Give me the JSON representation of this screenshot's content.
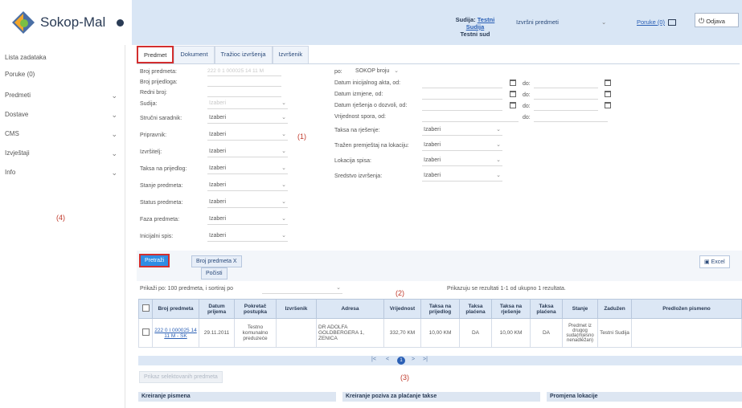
{
  "app": {
    "name": "Sokop-Mal",
    "header": {
      "judge_label": "Sudija:",
      "judge_name": "Testni Sudija",
      "court": "Testni sud",
      "module_select": "Izvršni predmeti",
      "messages_link": "Poruke (0)",
      "logout": "Odjava"
    }
  },
  "sidebar": {
    "items": [
      {
        "label": "Lista zadataka",
        "expandable": false
      },
      {
        "label": "Poruke (0)",
        "expandable": false
      },
      {
        "label": "Predmeti",
        "expandable": true
      },
      {
        "label": "Dostave",
        "expandable": true
      },
      {
        "label": "CMS",
        "expandable": true
      },
      {
        "label": "Izvještaji",
        "expandable": true
      },
      {
        "label": "Info",
        "expandable": true
      }
    ]
  },
  "annotations": [
    "(1)",
    "(2)",
    "(3)",
    "(4)"
  ],
  "tabs": [
    "Predmet",
    "Dokument",
    "Tražioc izvršenja",
    "Izvršenik"
  ],
  "form": {
    "left": [
      {
        "label": "Broj predmeta:",
        "type": "input",
        "value": "222 0 1 000025 14 11 M"
      },
      {
        "label": "Broj prijedloga:",
        "type": "input",
        "value": ""
      },
      {
        "label": "Redni broj:",
        "type": "input",
        "value": ""
      },
      {
        "label": "Sudija:",
        "type": "select",
        "value": "Izaberi",
        "disabled": true
      },
      {
        "label": "Stručni saradnik:",
        "type": "select",
        "value": "Izaberi"
      },
      {
        "label": "Pripravnik:",
        "type": "select",
        "value": "Izaberi"
      },
      {
        "label": "Izvršitelj:",
        "type": "select",
        "value": "Izaberi"
      },
      {
        "label": "Taksa na prijedlog:",
        "type": "select",
        "value": "Izaberi"
      },
      {
        "label": "Stanje predmeta:",
        "type": "select",
        "value": "Izaberi"
      },
      {
        "label": "Status predmeta:",
        "type": "select",
        "value": "Izaberi"
      },
      {
        "label": "Faza predmeta:",
        "type": "select",
        "value": "Izaberi"
      },
      {
        "label": "Inicijalni spis:",
        "type": "select",
        "value": "Izaberi"
      }
    ],
    "right": {
      "po_label": "po:",
      "po_value": "SOKOP broju",
      "date_rows": [
        {
          "label": "Datum inicijalnog akta, od:",
          "to": "do:"
        },
        {
          "label": "Datum izmjene, od:",
          "to": "do:"
        },
        {
          "label": "Datum rješenja o dozvoli, od:",
          "to": "do:"
        }
      ],
      "value_row": {
        "label": "Vrijednost spora, od:",
        "to": "do:"
      },
      "selects": [
        {
          "label": "Taksa na rješenje:",
          "value": "Izaberi"
        },
        {
          "label": "Tražen premještaj na lokaciju:",
          "value": "Izaberi"
        },
        {
          "label": "Lokacija spisa:",
          "value": "Izaberi"
        },
        {
          "label": "Sredstvo izvršenja:",
          "value": "Izaberi"
        }
      ]
    }
  },
  "actions": {
    "search": "Pretraži",
    "case_number": "Broj predmeta X",
    "clear": "Počisti",
    "excel": "Excel"
  },
  "listing": {
    "show_prefix": "Prikaži po:",
    "page_size": "100",
    "show_suffix": "predmeta, i sortiraj po",
    "results_text": "Prikazuju se rezultati 1-1 od ukupno 1 rezultata."
  },
  "table": {
    "columns": [
      "",
      "Broj predmeta",
      "Datum prijema",
      "Pokretač postupka",
      "Izvršenik",
      "Adresa",
      "Vrijednost",
      "Taksa na prijedlog",
      "Taksa plaćena",
      "Taksa na rješenje",
      "Taksa plaćena",
      "Stanje",
      "Zadužen",
      "Predložen pismeno"
    ],
    "rows": [
      [
        "",
        "222 0 I 000025 14 11 M - SK",
        "29.11.2011",
        "Testno komunalno preduzeće",
        "",
        "DR ADOLFA GOLDBERGERA 1, ZENICA",
        "332,70 KM",
        "10,00 KM",
        "DA",
        "10,00 KM",
        "DA",
        "Predmet iz drugog suda(mjesno nenadležan)",
        "Testni Sudija",
        ""
      ]
    ]
  },
  "pager": {
    "first": "|<",
    "prev": "<",
    "current": "1",
    "next": ">",
    "last": ">|"
  },
  "show_selected": "Prikaz selektovanih predmeta",
  "sections": [
    "Kreiranje pismena",
    "Kreiranje poziva za plaćanje takse",
    "Promjena lokacije"
  ]
}
